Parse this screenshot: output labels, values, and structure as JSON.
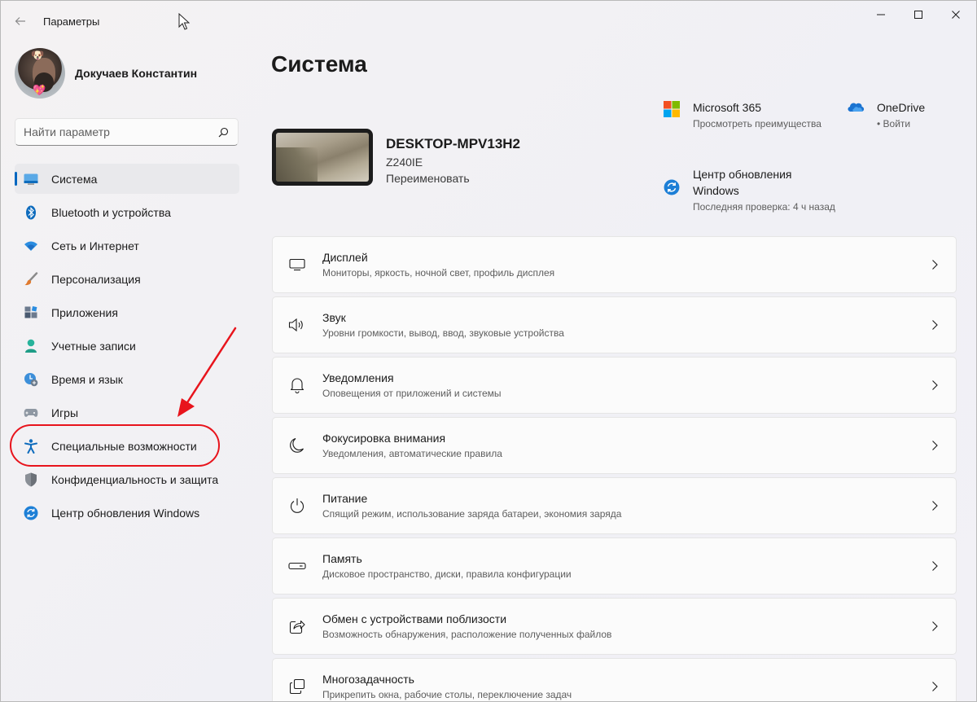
{
  "window": {
    "app_title": "Параметры"
  },
  "profile": {
    "name": "Докучаев Константин"
  },
  "search": {
    "placeholder": "Найти параметр"
  },
  "nav": {
    "items": [
      {
        "label": "Система",
        "icon": "system-icon",
        "active": true
      },
      {
        "label": "Bluetooth и устройства",
        "icon": "bluetooth-icon"
      },
      {
        "label": "Сеть и Интернет",
        "icon": "wifi-icon"
      },
      {
        "label": "Персонализация",
        "icon": "brush-icon"
      },
      {
        "label": "Приложения",
        "icon": "apps-icon"
      },
      {
        "label": "Учетные записи",
        "icon": "account-icon"
      },
      {
        "label": "Время и язык",
        "icon": "time-language-icon"
      },
      {
        "label": "Игры",
        "icon": "gamepad-icon"
      },
      {
        "label": "Специальные возможности",
        "icon": "accessibility-icon"
      },
      {
        "label": "Конфиденциальность и защита",
        "icon": "shield-icon"
      },
      {
        "label": "Центр обновления Windows",
        "icon": "windows-update-icon"
      }
    ]
  },
  "main": {
    "title": "Система",
    "device": {
      "name": "DESKTOP-MPV13H2",
      "model": "Z240IE",
      "rename": "Переименовать"
    },
    "promos": {
      "ms365": {
        "title": "Microsoft 365",
        "subtitle": "Просмотреть преимущества"
      },
      "onedrive": {
        "title": "OneDrive",
        "subtitle": "• Войти"
      },
      "update": {
        "title": "Центр обновления Windows",
        "subtitle": "Последняя проверка: 4 ч назад"
      }
    },
    "cards": [
      {
        "title": "Дисплей",
        "subtitle": "Мониторы, яркость, ночной свет, профиль дисплея",
        "icon": "display-icon"
      },
      {
        "title": "Звук",
        "subtitle": "Уровни громкости, вывод, ввод, звуковые устройства",
        "icon": "speaker-icon"
      },
      {
        "title": "Уведомления",
        "subtitle": "Оповещения от приложений и системы",
        "icon": "bell-icon"
      },
      {
        "title": "Фокусировка внимания",
        "subtitle": "Уведомления, автоматические правила",
        "icon": "moon-icon"
      },
      {
        "title": "Питание",
        "subtitle": "Спящий режим, использование заряда батареи, экономия заряда",
        "icon": "power-icon"
      },
      {
        "title": "Память",
        "subtitle": "Дисковое пространство, диски, правила конфигурации",
        "icon": "storage-icon"
      },
      {
        "title": "Обмен с устройствами поблизости",
        "subtitle": "Возможность обнаружения, расположение полученных файлов",
        "icon": "share-icon"
      },
      {
        "title": "Многозадачность",
        "subtitle": "Прикрепить окна, рабочие столы, переключение задач",
        "icon": "multitask-icon"
      }
    ]
  },
  "colors": {
    "accent": "#0067c0",
    "annotation": "#e8141c"
  }
}
